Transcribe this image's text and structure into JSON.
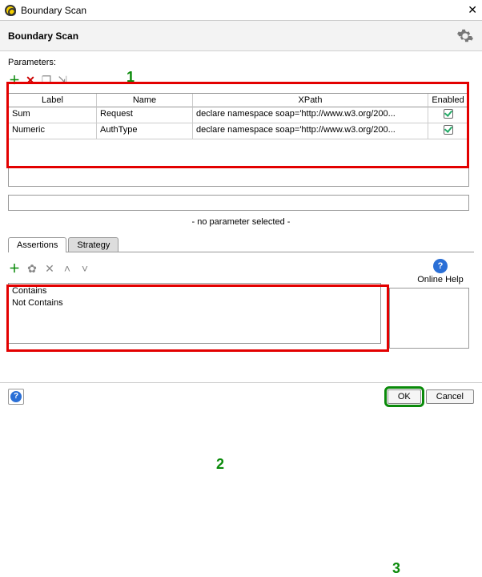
{
  "window": {
    "title": "Boundary Scan",
    "heading": "Boundary Scan"
  },
  "parameters": {
    "label": "Parameters:",
    "columns": {
      "label": "Label",
      "name": "Name",
      "xpath": "XPath",
      "enabled": "Enabled"
    },
    "rows": [
      {
        "label": "Sum",
        "name": "Request",
        "xpath": "declare namespace soap='http://www.w3.org/200...",
        "enabled": true
      },
      {
        "label": "Numeric",
        "name": "AuthType",
        "xpath": "declare namespace soap='http://www.w3.org/200...",
        "enabled": true
      }
    ],
    "no_selection": "- no parameter selected -"
  },
  "tabs": {
    "assertions": "Assertions",
    "strategy": "Strategy",
    "active": "assertions"
  },
  "assertions": {
    "items": [
      "Contains",
      "Not Contains"
    ]
  },
  "help": {
    "online": "Online Help"
  },
  "annotations": {
    "n1": "1",
    "n2": "2",
    "n3": "3"
  },
  "footer": {
    "ok": "OK",
    "cancel": "Cancel"
  }
}
